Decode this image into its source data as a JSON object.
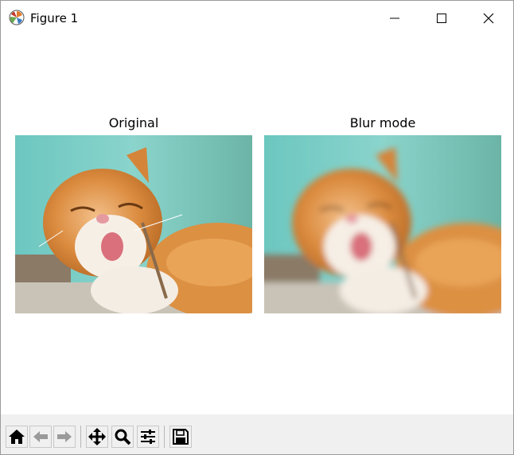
{
  "window": {
    "title": "Figure 1",
    "app_icon": "matplotlib-logo-icon",
    "controls": [
      "minimize-icon",
      "maximize-icon",
      "close-icon"
    ]
  },
  "figure": {
    "subplots": [
      {
        "title": "Original",
        "image": "photo of an orange-and-white cat licking its nose against a teal background",
        "render": "sharp"
      },
      {
        "title": "Blur mode",
        "image": "same cat photo with a blur filter applied",
        "render": "blurred"
      }
    ]
  },
  "toolbar": {
    "buttons": [
      {
        "icon": "home-icon",
        "enabled": true
      },
      {
        "icon": "back-arrow-icon",
        "enabled": false
      },
      {
        "icon": "forward-arrow-icon",
        "enabled": false
      },
      {
        "icon": "pan-move-icon",
        "enabled": true
      },
      {
        "icon": "zoom-magnifier-icon",
        "enabled": true
      },
      {
        "icon": "configure-subplots-icon",
        "enabled": true
      },
      {
        "icon": "save-floppy-icon",
        "enabled": true
      }
    ]
  },
  "colors": {
    "background_teal": "#7fcfc4",
    "cat_orange": "#d98a3c",
    "toolbar_bg": "#f0f0f0"
  }
}
